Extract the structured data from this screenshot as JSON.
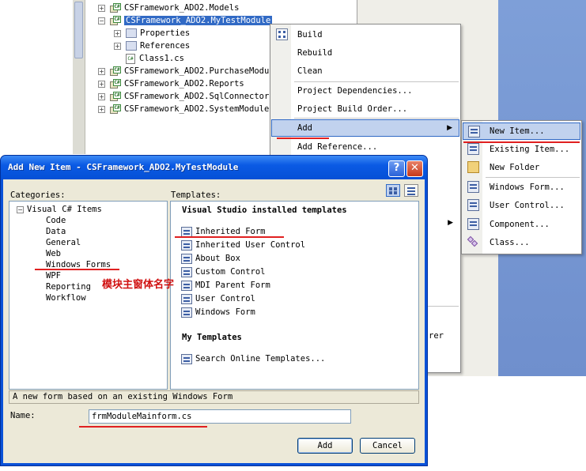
{
  "solution_tree": {
    "nodes": [
      {
        "name": "CSFramework_ADO2.Models",
        "expander": "+",
        "selected": false
      },
      {
        "name": "CSFramework_ADO2.MyTestModule",
        "expander": "−",
        "selected": true
      },
      {
        "name": "Properties",
        "expander": "+",
        "selected": false
      },
      {
        "name": "References",
        "expander": "+",
        "selected": false
      },
      {
        "name": "Class1.cs",
        "expander": "",
        "selected": false
      },
      {
        "name": "CSFramework_ADO2.PurchaseModu",
        "expander": "+",
        "selected": false
      },
      {
        "name": "CSFramework_ADO2.Reports",
        "expander": "+",
        "selected": false
      },
      {
        "name": "CSFramework_ADO2.SqlConnector",
        "expander": "+",
        "selected": false
      },
      {
        "name": "CSFramework_ADO2.SystemModule",
        "expander": "+",
        "selected": false
      }
    ]
  },
  "context_menu": {
    "build": "Build",
    "rebuild": "Rebuild",
    "clean": "Clean",
    "project_dependencies": "Project Dependencies...",
    "project_build_order": "Project Build Order...",
    "add": "Add",
    "add_reference": "Add Reference...",
    "partial_rer": "rer"
  },
  "add_submenu": {
    "new_item": "New Item...",
    "existing_item": "Existing Item...",
    "new_folder": "New Folder",
    "windows_form": "Windows Form...",
    "user_control": "User Control...",
    "component": "Component...",
    "class": "Class..."
  },
  "dialog": {
    "title": "Add New Item - CSFramework_ADO2.MyTestModule",
    "help": "?",
    "close": "✕",
    "categories_label": "Categories:",
    "templates_label": "Templates:",
    "categories": {
      "root": "Visual C# Items",
      "items": [
        "Code",
        "Data",
        "General",
        "Web",
        "Windows Forms",
        "WPF",
        "Reporting",
        "Workflow"
      ],
      "root_expander": "−"
    },
    "templates": {
      "installed_header": "Visual Studio installed templates",
      "installed": [
        "Inherited Form",
        "Inherited User Control",
        "About Box",
        "Custom Control",
        "MDI Parent Form",
        "User Control",
        "Windows Form"
      ],
      "my_header": "My Templates",
      "my": [
        "Search Online Templates..."
      ]
    },
    "description": "A new form based on an existing Windows Form",
    "name_label": "Name:",
    "name_value": "frmModuleMainform.cs",
    "add_button": "Add",
    "cancel_button": "Cancel"
  },
  "annotation": "模块主窗体名字",
  "colors": {
    "highlight": "#316ac5",
    "menu_highlight": "#c1d2ee",
    "annotation_red": "#e02020",
    "dialog_face": "#ece9d8",
    "title_blue": "#0b5ae4"
  }
}
